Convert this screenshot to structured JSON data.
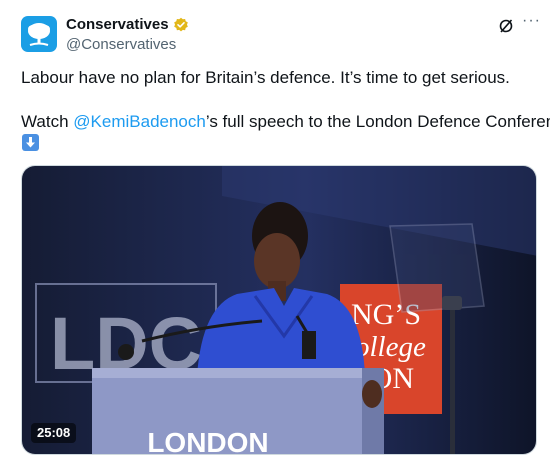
{
  "account": {
    "display_name": "Conservatives",
    "handle": "@Conservatives",
    "brand_color": "#1b9ee5",
    "verified_badge_color": "#e2b719"
  },
  "tweet": {
    "line1": "Labour have no plan for Britain’s defence. It’s time to get serious.",
    "line2_prefix": "Watch ",
    "mention": "@KemiBadenoch",
    "line2_suffix": "’s full speech to the London Defence Conference",
    "emoji": "down-arrow-emoji"
  },
  "media": {
    "duration": "25:08",
    "podium_text": "LONDON",
    "banner_left_text": "LDC",
    "banner_right_lines": [
      "NG’S",
      "ollege",
      "DON"
    ],
    "banner_right_color": "#d9452b"
  },
  "icons": {
    "grok": "grok-icon",
    "more": "more-icon",
    "more_glyph": "···"
  }
}
